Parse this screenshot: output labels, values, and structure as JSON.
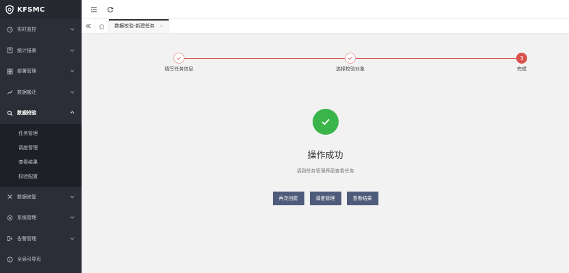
{
  "app": {
    "logo_text": "KFSMC"
  },
  "sidebar": {
    "items": [
      {
        "label": "实时监控",
        "icon": "gauge-icon"
      },
      {
        "label": "统计报表",
        "icon": "report-icon"
      },
      {
        "label": "部署管理",
        "icon": "deploy-icon"
      },
      {
        "label": "数据搬迁",
        "icon": "migrate-icon"
      },
      {
        "label": "数据校验",
        "icon": "search-icon",
        "active": true,
        "children": [
          "任务管理",
          "调度管理",
          "查看结果",
          "校验配置"
        ]
      },
      {
        "label": "数据修复",
        "icon": "repair-icon"
      },
      {
        "label": "系统管理",
        "icon": "gear-icon"
      },
      {
        "label": "告警管理",
        "icon": "alarm-icon"
      },
      {
        "label": "全局引导页",
        "icon": "info-icon"
      }
    ]
  },
  "tabs": [
    {
      "label": "数据校验-新建任务",
      "close": "×"
    }
  ],
  "steps": [
    {
      "label": "填写任务信息",
      "state": "done"
    },
    {
      "label": "选择校验对象",
      "state": "done"
    },
    {
      "label": "完成",
      "number": "3",
      "state": "current"
    }
  ],
  "result": {
    "title": "操作成功",
    "subtitle": "请到任务管理界面查看任务",
    "buttons": [
      "再次创建",
      "调度管理",
      "查看结果"
    ]
  },
  "colors": {
    "sidebar": "#2b2e36",
    "accent": "#d9534f",
    "success": "#3ab54a",
    "button": "#4f5b7a"
  }
}
